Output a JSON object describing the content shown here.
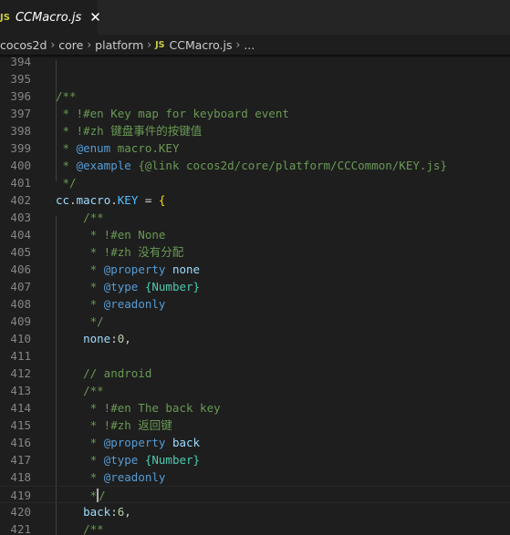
{
  "colors": {
    "comment": "#6a9955",
    "doc_tag": "#569cd6",
    "doc_type": "#4ec9b0",
    "doc_param": "#9cdcfe",
    "identifier": "#9cdcfe",
    "constant": "#4fc1ff",
    "number": "#b5cea8",
    "plain": "#d4d4d4",
    "bracket": "#ffd700",
    "line_number": "#858585",
    "js_icon": "#cbcb41"
  },
  "tab": {
    "icon": "JS",
    "title": "CCMacro.js",
    "close": "✕"
  },
  "breadcrumb": {
    "items": [
      "cocos2d",
      "core",
      "platform"
    ],
    "file_icon": "JS",
    "file": "CCMacro.js",
    "ellipsis": "..."
  },
  "lines": [
    {
      "n": "394",
      "tokens": []
    },
    {
      "n": "395",
      "tokens": []
    },
    {
      "n": "396",
      "tokens": [
        {
          "t": "/**",
          "c": "comment"
        }
      ]
    },
    {
      "n": "397",
      "tokens": [
        {
          "t": " * !#en Key map for keyboard event",
          "c": "comment"
        }
      ]
    },
    {
      "n": "398",
      "tokens": [
        {
          "t": " * !#zh 键盘事件的按键值",
          "c": "comment"
        }
      ]
    },
    {
      "n": "399",
      "tokens": [
        {
          "t": " * ",
          "c": "comment"
        },
        {
          "t": "@enum",
          "c": "doc_tag"
        },
        {
          "t": " macro.KEY",
          "c": "comment"
        }
      ]
    },
    {
      "n": "400",
      "tokens": [
        {
          "t": " * ",
          "c": "comment"
        },
        {
          "t": "@example",
          "c": "doc_tag"
        },
        {
          "t": " {@link cocos2d/core/platform/CCCommon/KEY.js}",
          "c": "comment"
        }
      ]
    },
    {
      "n": "401",
      "tokens": [
        {
          "t": " */",
          "c": "comment"
        }
      ]
    },
    {
      "n": "402",
      "tokens": [
        {
          "t": "cc",
          "c": "identifier"
        },
        {
          "t": ".",
          "c": "plain"
        },
        {
          "t": "macro",
          "c": "identifier"
        },
        {
          "t": ".",
          "c": "plain"
        },
        {
          "t": "KEY",
          "c": "constant"
        },
        {
          "t": " = ",
          "c": "plain"
        },
        {
          "t": "{",
          "c": "bracket"
        }
      ]
    },
    {
      "n": "403",
      "tokens": [
        {
          "t": "    /**",
          "c": "comment"
        }
      ]
    },
    {
      "n": "404",
      "tokens": [
        {
          "t": "     * !#en None",
          "c": "comment"
        }
      ]
    },
    {
      "n": "405",
      "tokens": [
        {
          "t": "     * !#zh 没有分配",
          "c": "comment"
        }
      ]
    },
    {
      "n": "406",
      "tokens": [
        {
          "t": "     * ",
          "c": "comment"
        },
        {
          "t": "@property",
          "c": "doc_tag"
        },
        {
          "t": " ",
          "c": "comment"
        },
        {
          "t": "none",
          "c": "doc_param"
        }
      ]
    },
    {
      "n": "407",
      "tokens": [
        {
          "t": "     * ",
          "c": "comment"
        },
        {
          "t": "@type",
          "c": "doc_tag"
        },
        {
          "t": " ",
          "c": "comment"
        },
        {
          "t": "{Number}",
          "c": "doc_type"
        }
      ]
    },
    {
      "n": "408",
      "tokens": [
        {
          "t": "     * ",
          "c": "comment"
        },
        {
          "t": "@readonly",
          "c": "doc_tag"
        }
      ]
    },
    {
      "n": "409",
      "tokens": [
        {
          "t": "     */",
          "c": "comment"
        }
      ]
    },
    {
      "n": "410",
      "tokens": [
        {
          "t": "    ",
          "c": "plain"
        },
        {
          "t": "none",
          "c": "identifier"
        },
        {
          "t": ":",
          "c": "plain"
        },
        {
          "t": "0",
          "c": "number"
        },
        {
          "t": ",",
          "c": "plain"
        }
      ]
    },
    {
      "n": "411",
      "tokens": []
    },
    {
      "n": "412",
      "tokens": [
        {
          "t": "    // android",
          "c": "comment"
        }
      ]
    },
    {
      "n": "413",
      "tokens": [
        {
          "t": "    /**",
          "c": "comment"
        }
      ]
    },
    {
      "n": "414",
      "tokens": [
        {
          "t": "     * !#en The back key",
          "c": "comment"
        }
      ]
    },
    {
      "n": "415",
      "tokens": [
        {
          "t": "     * !#zh 返回键",
          "c": "comment"
        }
      ]
    },
    {
      "n": "416",
      "tokens": [
        {
          "t": "     * ",
          "c": "comment"
        },
        {
          "t": "@property",
          "c": "doc_tag"
        },
        {
          "t": " ",
          "c": "comment"
        },
        {
          "t": "back",
          "c": "doc_param"
        }
      ]
    },
    {
      "n": "417",
      "tokens": [
        {
          "t": "     * ",
          "c": "comment"
        },
        {
          "t": "@type",
          "c": "doc_tag"
        },
        {
          "t": " ",
          "c": "comment"
        },
        {
          "t": "{Number}",
          "c": "doc_type"
        }
      ]
    },
    {
      "n": "418",
      "tokens": [
        {
          "t": "     * ",
          "c": "comment"
        },
        {
          "t": "@readonly",
          "c": "doc_tag"
        }
      ]
    },
    {
      "n": "419",
      "tokens": [
        {
          "t": "     */",
          "c": "comment"
        }
      ],
      "current": true
    },
    {
      "n": "420",
      "tokens": [
        {
          "t": "    ",
          "c": "plain"
        },
        {
          "t": "back",
          "c": "identifier"
        },
        {
          "t": ":",
          "c": "plain"
        },
        {
          "t": "6",
          "c": "number"
        },
        {
          "t": ",",
          "c": "plain"
        }
      ]
    },
    {
      "n": "421",
      "tokens": [
        {
          "t": "    /**",
          "c": "comment"
        }
      ]
    }
  ]
}
